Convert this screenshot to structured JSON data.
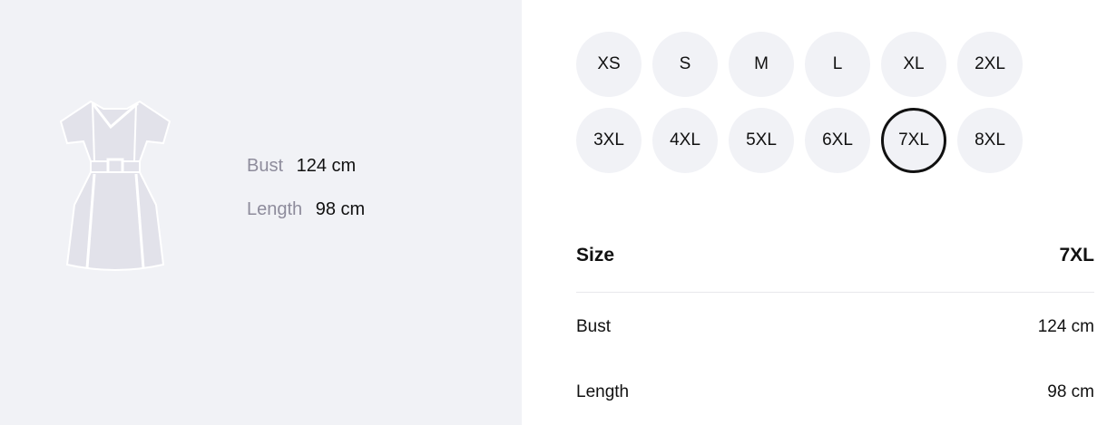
{
  "measurements_panel": {
    "image_icon": "dress-icon",
    "rows": [
      {
        "label": "Bust",
        "value": "124 cm"
      },
      {
        "label": "Length",
        "value": "98 cm"
      }
    ]
  },
  "size_selector": {
    "rows": [
      [
        "XS",
        "S",
        "M",
        "L",
        "XL",
        "2XL"
      ],
      [
        "3XL",
        "4XL",
        "5XL",
        "6XL",
        "7XL",
        "8XL"
      ]
    ],
    "selected": "7XL"
  },
  "size_table": {
    "header_label": "Size",
    "header_value": "7XL",
    "rows": [
      {
        "label": "Bust",
        "value": "124 cm"
      },
      {
        "label": "Length",
        "value": "98 cm"
      }
    ]
  },
  "colors": {
    "panel_bg": "#f1f2f6",
    "chip_bg": "#f1f2f6",
    "selected_border": "#111111",
    "muted_label": "#8e8c9c",
    "dress_fill": "#e2e2ea"
  }
}
